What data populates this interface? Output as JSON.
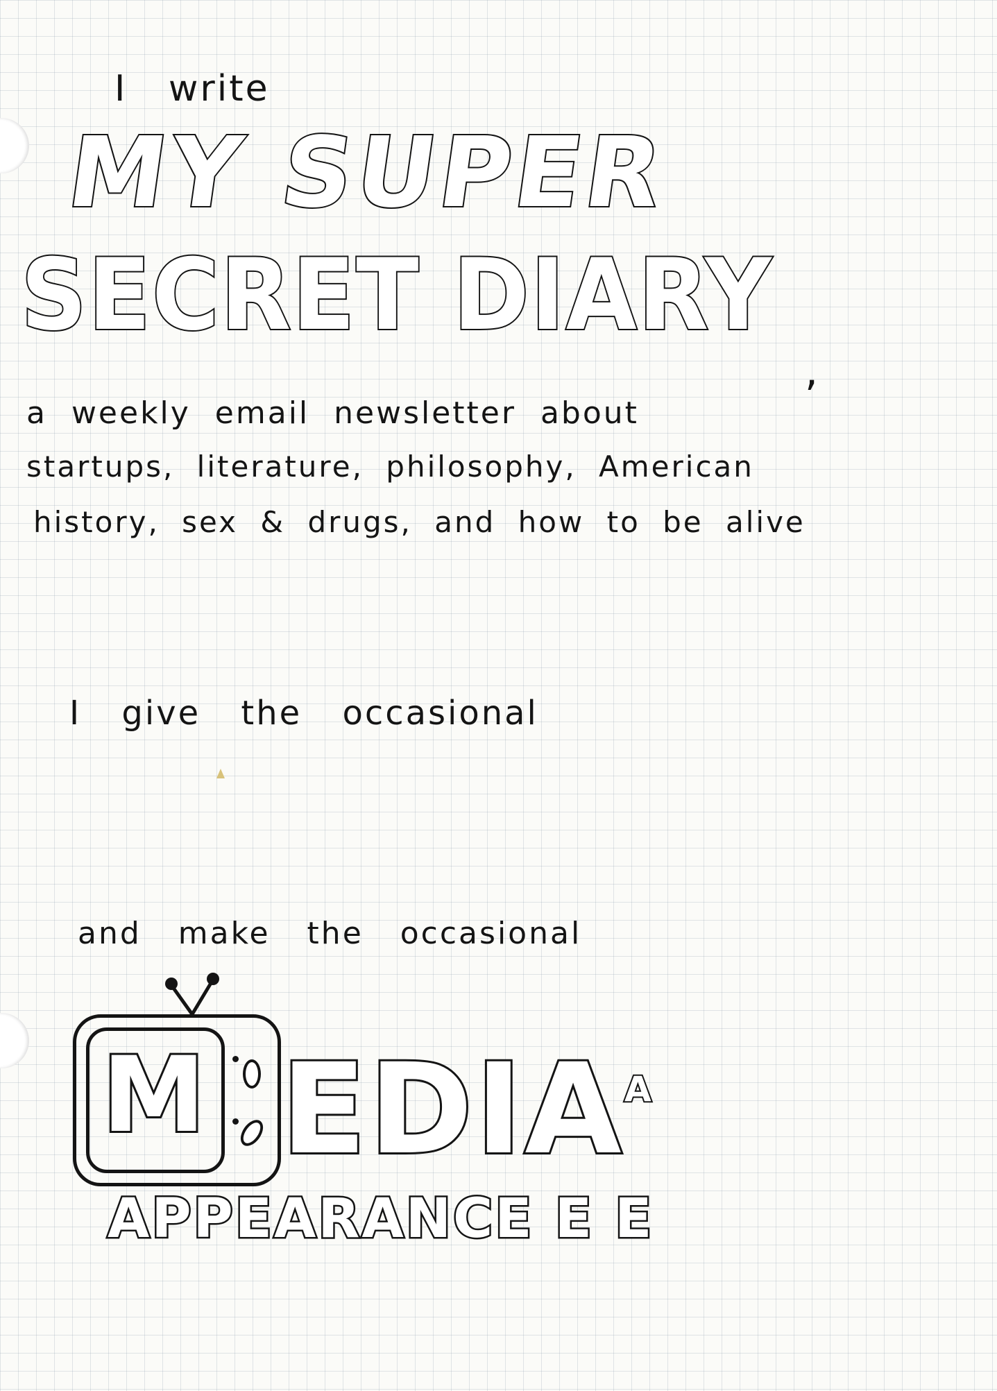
{
  "intro": "I write",
  "title_line1": "MY SUPER",
  "title_line2": "SECRET DIARY",
  "title_comma": ",",
  "description_lines": [
    "a weekly email newsletter about",
    "startups, literature, philosophy, American",
    "history, sex & drugs, and how to be alive"
  ],
  "talk_line": "I give the occasional",
  "media_line": "and make the occasional",
  "media_word": "EDIA",
  "media_m": "M",
  "media_sub": "APPEARANCE E E",
  "media_tick": "A",
  "icons": {
    "hole_top": "binder-hole-icon",
    "hole_bottom": "binder-hole-icon",
    "tv": "tv-icon"
  },
  "colors": {
    "ink": "#141414",
    "paper": "#fbfbf8",
    "grid": "#96a5b4"
  }
}
